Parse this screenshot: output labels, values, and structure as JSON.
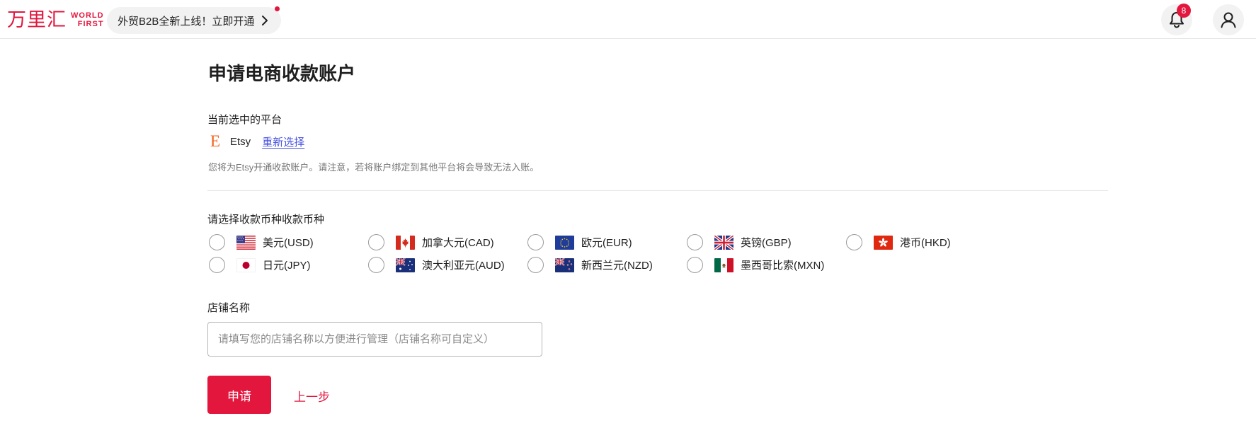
{
  "header": {
    "logo_cn": "万里汇",
    "logo_en_line1": "WORLD",
    "logo_en_line2": "FIRST",
    "promo_text": "外贸B2B全新上线！立即开通",
    "notification_count": "8"
  },
  "page": {
    "title": "申请电商收款账户"
  },
  "platform_section": {
    "label": "当前选中的平台",
    "platform_logo_letter": "E",
    "platform_name": "Etsy",
    "reselect_label": "重新选择",
    "hint": "您将为Etsy开通收款账户。请注意，若将账户绑定到其他平台将会导致无法入账。"
  },
  "currency_section": {
    "label": "请选择收款币种收款币种",
    "options": [
      {
        "label": "美元(USD)",
        "flag": "us-flag"
      },
      {
        "label": "加拿大元(CAD)",
        "flag": "ca-flag"
      },
      {
        "label": "欧元(EUR)",
        "flag": "eu-flag"
      },
      {
        "label": "英镑(GBP)",
        "flag": "gb-flag"
      },
      {
        "label": "港币(HKD)",
        "flag": "hk-flag"
      },
      {
        "label": "日元(JPY)",
        "flag": "jp-flag"
      },
      {
        "label": "澳大利亚元(AUD)",
        "flag": "au-flag"
      },
      {
        "label": "新西兰元(NZD)",
        "flag": "nz-flag"
      },
      {
        "label": "墨西哥比索(MXN)",
        "flag": "mx-flag"
      }
    ]
  },
  "store_section": {
    "label": "店铺名称",
    "input_value": "",
    "input_placeholder": "请填写您的店铺名称以方便进行管理（店铺名称可自定义）"
  },
  "actions": {
    "apply_label": "申请",
    "back_label": "上一步"
  },
  "colors": {
    "brand_red": "#e3173e",
    "link_blue": "#4a55e0",
    "etsy_orange": "#f1641e"
  }
}
